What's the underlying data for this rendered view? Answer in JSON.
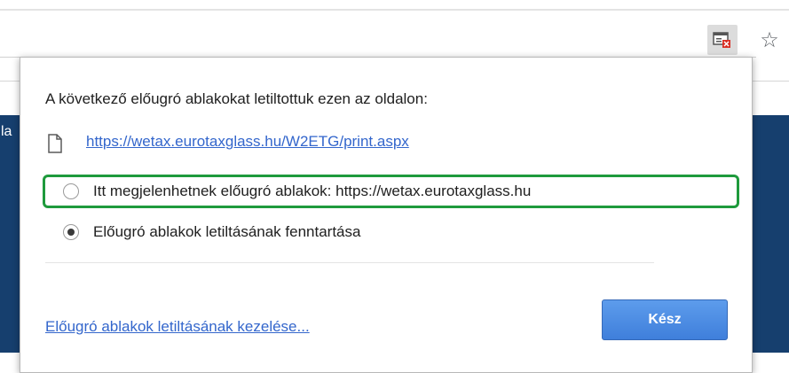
{
  "toolbar": {
    "popup_blocked_icon": "popup-blocked-icon",
    "bookmark_icon": "star-icon",
    "bookmark_glyph": "☆"
  },
  "page": {
    "partial_text": "la"
  },
  "bubble": {
    "title": "A következő előugró ablakokat letiltottuk ezen az oldalon:",
    "blocked_url": "https://wetax.eurotaxglass.hu/W2ETG/print.aspx",
    "options": [
      {
        "label": "Itt megjelenhetnek előugró ablakok: https://wetax.eurotaxglass.hu",
        "selected": false
      },
      {
        "label": "Előugró ablakok letiltásának fenntartása",
        "selected": true
      }
    ],
    "manage_link": "Előugró ablakok letiltásának kezelése...",
    "done_label": "Kész"
  },
  "colors": {
    "link": "#3366cc",
    "highlight": "#1e9a3c",
    "button": "#4a8ae0",
    "page_band": "#163f6e"
  }
}
